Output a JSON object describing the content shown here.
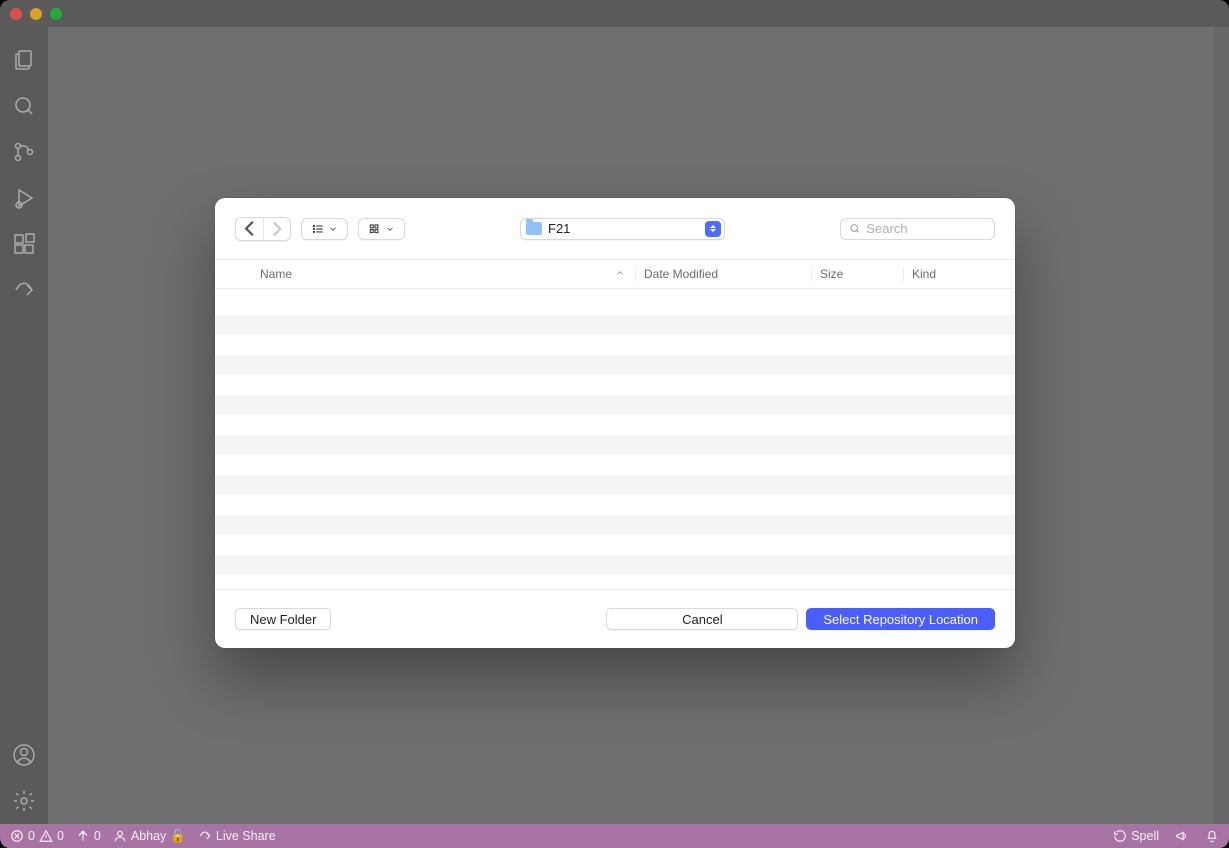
{
  "statusbar": {
    "errors": "0",
    "warnings": "0",
    "ports": "0",
    "user": "Abhay",
    "liveshare": "Live Share",
    "spell": "Spell"
  },
  "dialog": {
    "folder": "F21",
    "search_placeholder": "Search",
    "columns": {
      "name": "Name",
      "date": "Date Modified",
      "size": "Size",
      "kind": "Kind"
    },
    "footer": {
      "new_folder": "New Folder",
      "cancel": "Cancel",
      "select": "Select Repository Location"
    }
  }
}
